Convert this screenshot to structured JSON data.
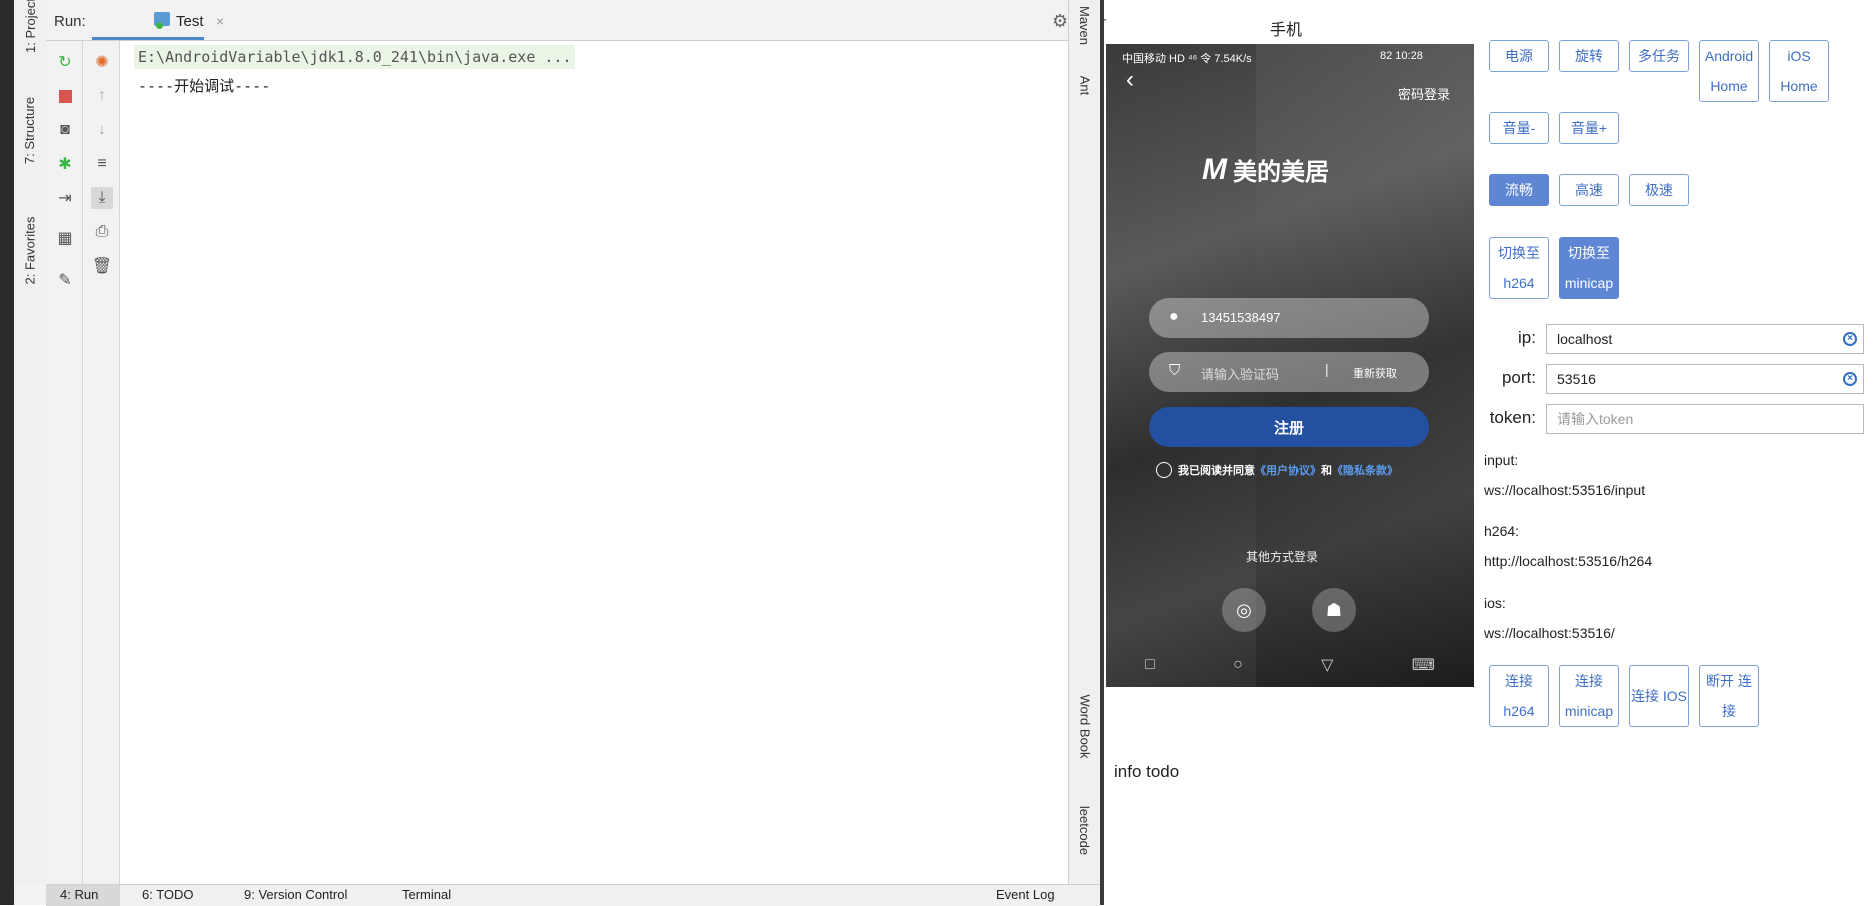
{
  "ide": {
    "left_tabs": [
      "1: Project",
      "7: Structure",
      "2: Favorites"
    ],
    "right_tabs": [
      "Maven",
      "Ant",
      "Word Book",
      "leetcode"
    ],
    "run_label": "Run:",
    "run_tab": "Test",
    "run_tab_close": "×",
    "console": {
      "command": "E:\\AndroidVariable\\jdk1.8.0_241\\bin\\java.exe ...",
      "output": "----开始调试----"
    },
    "statusbar": {
      "run": "4: Run",
      "todo": "6: TODO",
      "vcs": "9: Version Control",
      "terminal": "Terminal",
      "event_log": "Event Log"
    }
  },
  "app": {
    "title": "手机",
    "phone": {
      "status_left": "中国移动 HD ⁴⁶ 令 7.54K/s",
      "status_right": "82 10:28",
      "back": "‹",
      "pwd_login": "密码登录",
      "brand": "美的美居",
      "phone_number": "13451538497",
      "code_placeholder": "请输入验证码",
      "resend": "重新获取",
      "register": "注册",
      "agree_prefix": "我已阅读并同意",
      "user_agreement": "《用户协议》",
      "and": "和",
      "privacy": "《隐私条款》",
      "other_login": "其他方式登录"
    },
    "buttons_row1": [
      "电源",
      "旋转",
      "多任务",
      "Android Home",
      "iOS Home"
    ],
    "buttons_row2": [
      "音量-",
      "音量+"
    ],
    "quality": [
      "流畅",
      "高速",
      "极速"
    ],
    "switch": [
      "切换至 h264",
      "切换至 minicap"
    ],
    "ip_label": "ip:",
    "ip_value": "localhost",
    "port_label": "port:",
    "port_value": "53516",
    "token_label": "token:",
    "token_placeholder": "请输入token",
    "input_label": "input:",
    "input_url": "ws://localhost:53516/input",
    "h264_label": "h264:",
    "h264_url": "http://localhost:53516/h264",
    "ios_label": "ios:",
    "ios_url": "ws://localhost:53516/",
    "connect": [
      "连接 h264",
      "连接 minicap",
      "连接 IOS",
      "断开 连接"
    ],
    "info": "info todo"
  }
}
